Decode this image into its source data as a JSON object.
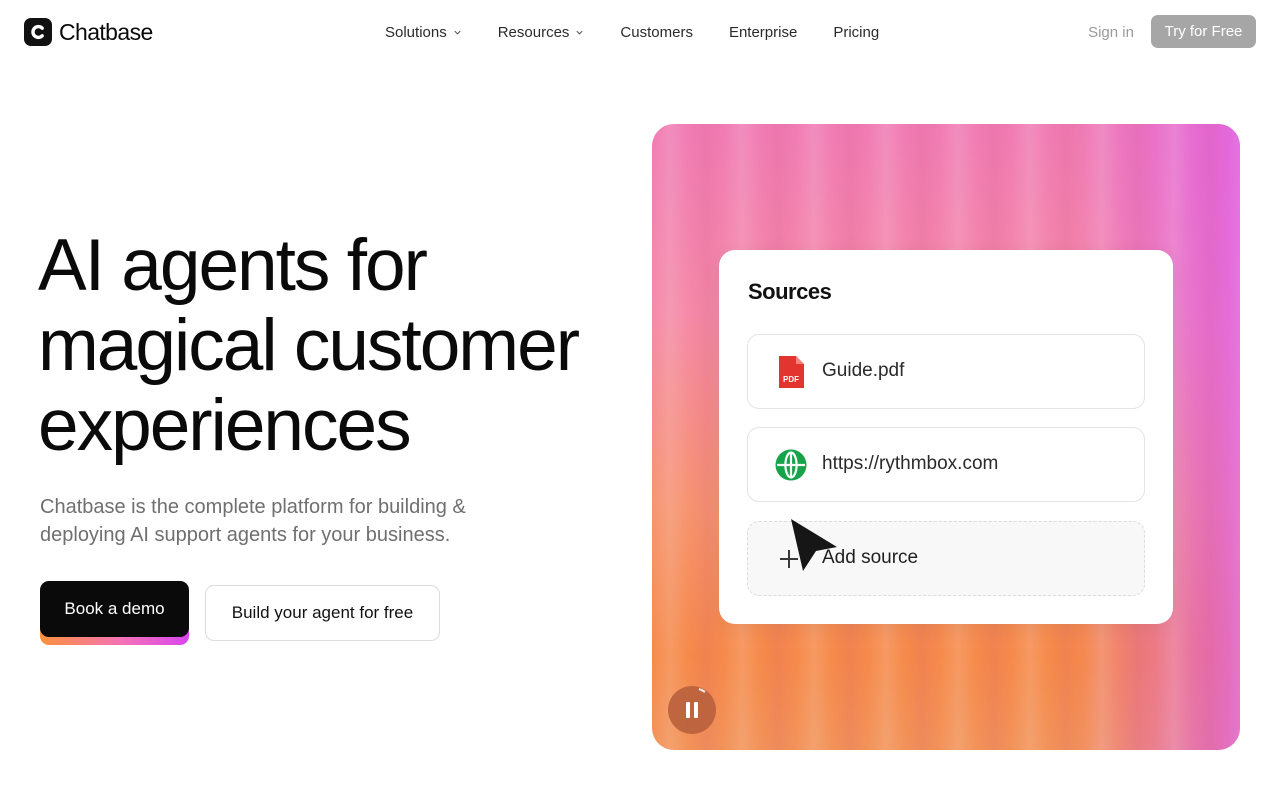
{
  "header": {
    "logo_text": "Chatbase",
    "nav": [
      {
        "label": "Solutions",
        "has_dropdown": true
      },
      {
        "label": "Resources",
        "has_dropdown": true
      },
      {
        "label": "Customers",
        "has_dropdown": false
      },
      {
        "label": "Enterprise",
        "has_dropdown": false
      },
      {
        "label": "Pricing",
        "has_dropdown": false
      }
    ],
    "signin_label": "Sign in",
    "cta_label": "Try for Free"
  },
  "hero": {
    "title_lines": [
      "AI agents for",
      "magical customer",
      "experiences"
    ],
    "subtitle_line1": "Chatbase is the complete platform for building &",
    "subtitle_line2": "deploying AI support agents for your business.",
    "primary_button": "Book a demo",
    "secondary_button": "Build your agent for free"
  },
  "visual": {
    "card_title": "Sources",
    "sources": [
      {
        "label": "Guide.pdf",
        "icon": "pdf-file-icon",
        "icon_text": "PDF"
      },
      {
        "label": "https://rythmbox.com",
        "icon": "globe-icon"
      }
    ],
    "add_label": "Add source",
    "pause_icon": "pause-icon"
  },
  "colors": {
    "cta_gray": "#a6a6a6",
    "primary_black": "#0a0a0a",
    "pdf_red": "#e3342f",
    "globe_green": "#16a34a",
    "visual_pink": "#f07cb4",
    "visual_orange": "#f58a4a",
    "visual_magenta": "#dd5fec"
  }
}
